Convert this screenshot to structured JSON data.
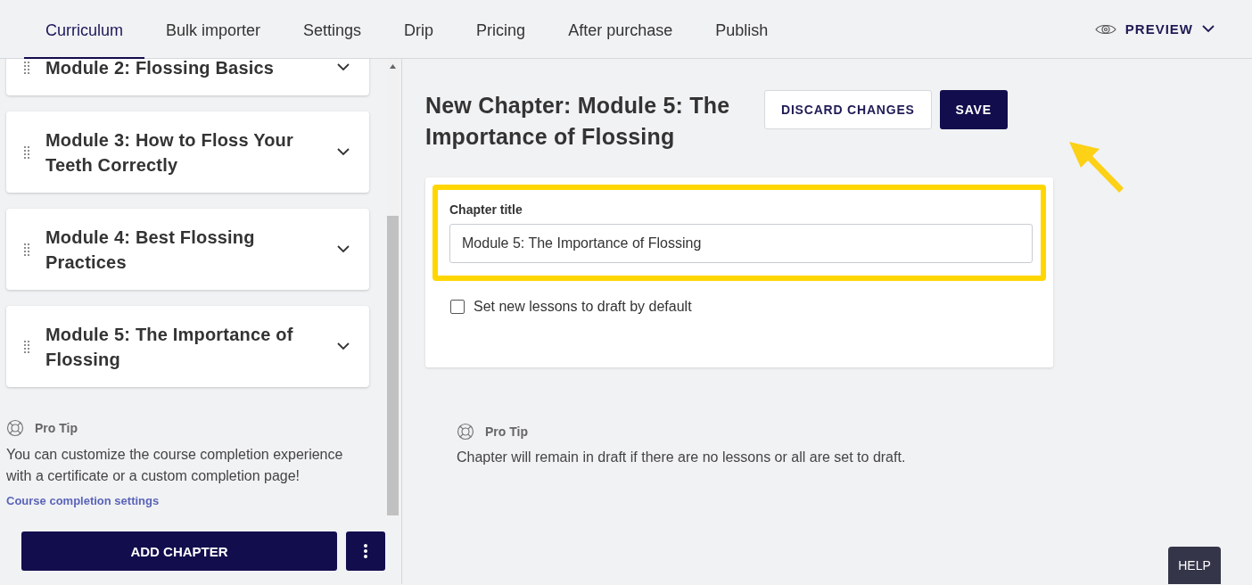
{
  "tabs": [
    {
      "label": "Curriculum",
      "selected": true
    },
    {
      "label": "Bulk importer",
      "selected": false
    },
    {
      "label": "Settings",
      "selected": false
    },
    {
      "label": "Drip",
      "selected": false
    },
    {
      "label": "Pricing",
      "selected": false
    },
    {
      "label": "After purchase",
      "selected": false
    },
    {
      "label": "Publish",
      "selected": false
    }
  ],
  "preview": {
    "label": "PREVIEW"
  },
  "sidebar": {
    "modules": [
      {
        "title": "Module 2: Flossing Basics"
      },
      {
        "title": "Module 3: How to Floss Your Teeth Correctly"
      },
      {
        "title": "Module 4: Best Flossing Practices"
      },
      {
        "title": "Module 5: The Importance of Flossing"
      }
    ],
    "tip": {
      "heading": "Pro Tip",
      "text": "You can customize the course completion experience with a certificate or a custom completion page!",
      "link": "Course completion settings"
    },
    "add_button": "ADD CHAPTER"
  },
  "editor": {
    "heading": "New Chapter: Module 5: The Importance of Flossing",
    "discard_button": "DISCARD CHANGES",
    "save_button": "SAVE",
    "field": {
      "label": "Chapter title",
      "value": "Module 5: The Importance of Flossing"
    },
    "checkbox": {
      "label": "Set new lessons to draft by default",
      "checked": false
    },
    "tip": {
      "heading": "Pro Tip",
      "text": "Chapter will remain in draft if there are no lessons or all are set to draft."
    }
  },
  "help_button": "HELP"
}
